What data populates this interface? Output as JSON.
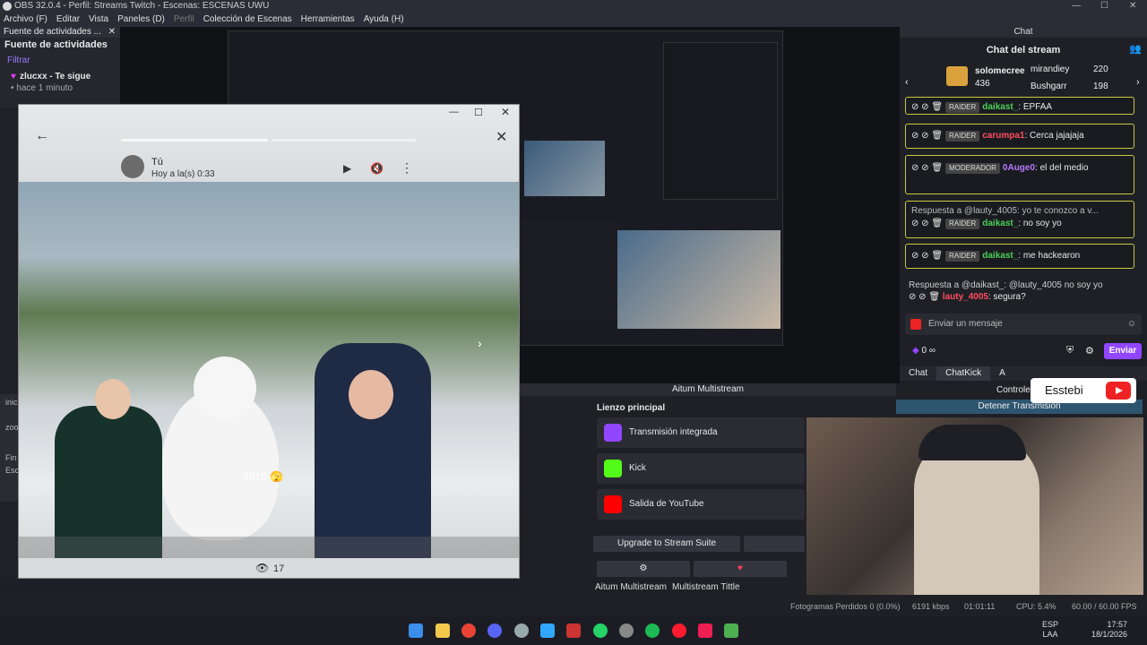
{
  "window": {
    "title": "OBS 32.0.4 - Perfil: Streams Twitch - Escenas: ESCENAS UWU"
  },
  "menu": [
    "Archivo (F)",
    "Editar",
    "Vista",
    "Paneles (D)",
    "Perfil",
    "Colección de Escenas",
    "Herramientas",
    "Ayuda (H)"
  ],
  "activity": {
    "dock_title": "Fuente de actividades ...",
    "title": "Fuente de actividades",
    "filter": "Filtrar",
    "item_user": "zlucxx",
    "item_action": "- Te sigue",
    "item_time": "• hace 1 minuto"
  },
  "left_labels": [
    "inic",
    "zoo",
    "Fin",
    "Esc"
  ],
  "viewer": {
    "author": "Tú",
    "time": "Hoy a la(s) 0:33",
    "caption": "2016 🫣",
    "views": "17"
  },
  "chat": {
    "dock_title": "Chat",
    "title": "Chat del stream",
    "leaders": [
      {
        "name": "solomecree",
        "value": "436"
      },
      {
        "name": "mirandiey",
        "value": "220"
      },
      {
        "name": "Bushgarr",
        "value": "198"
      }
    ],
    "messages": [
      {
        "badge": "RAIDER",
        "user": "daikast_",
        "text": ": EPFAA"
      },
      {
        "badge": "RAIDER",
        "user": "carumpa1",
        "text": ": Cerca jajajaja"
      },
      {
        "badge": "MODERADOR",
        "user": "0Auge0",
        "text": ": el del medio"
      },
      {
        "reply": "Respuesta a @lauty_4005: yo te conozco a v...",
        "badge": "RAIDER",
        "user": "daikast_",
        "text": ": no soy yo"
      },
      {
        "badge": "RAIDER",
        "user": "daikast_",
        "text": ": me hackearon"
      },
      {
        "reply": "Respuesta a @daikast_: @lauty_4005 no soy yo",
        "user": "lauty_4005",
        "text": ": segura?"
      }
    ],
    "input_placeholder": "Enviar un mensaje",
    "points": "0",
    "points_suffix": "∞",
    "send": "Enviar",
    "tabs": [
      "Chat",
      "ChatKick",
      "A"
    ]
  },
  "multistream": {
    "title": "Aitum Multistream",
    "section": "Lienzo principal",
    "outputs": [
      {
        "label": "Transmisión integrada",
        "color": "#9146ff"
      },
      {
        "label": "Kick",
        "color": "#53fc18"
      },
      {
        "label": "Salida de YouTube",
        "color": "#ff0000"
      }
    ],
    "upgrade": "Upgrade to Stream Suite",
    "tabs": [
      "Aitum Multistream",
      "Multistream Tittle"
    ]
  },
  "controls": {
    "title": "Controles",
    "stop": "Detener Transmisión"
  },
  "overlay_name": "Esstebi",
  "status": {
    "frames": "Fotogramas Perdidos 0 (0.0%)",
    "bitrate": "6191 kbps",
    "time": "01:01:11",
    "cpu": "CPU: 5.4%",
    "fps": "60.00 / 60.00 FPS"
  },
  "taskbar": {
    "lang1": "ESP",
    "lang2": "LAA",
    "time": "17:57",
    "date": "18/1/2026"
  }
}
